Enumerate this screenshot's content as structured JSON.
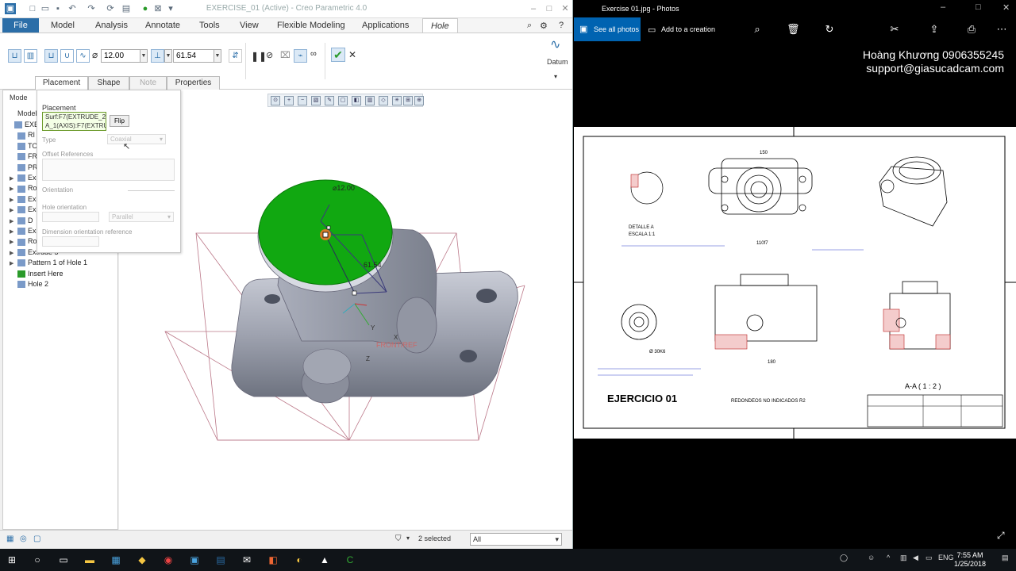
{
  "creo": {
    "window_title": "EXERCISE_01 (Active) - Creo Parametric 4.0",
    "menu": [
      "File",
      "Model",
      "Analysis",
      "Annotate",
      "Tools",
      "View",
      "Flexible Modeling",
      "Applications",
      "Hole"
    ],
    "ribbon": {
      "diameter_value": "12.00",
      "depth_value": "61.54",
      "datum_label": "Datum"
    },
    "dashboard_tabs": [
      "Placement",
      "Shape",
      "Note",
      "Properties"
    ],
    "placement_panel": {
      "heading": "Placement",
      "refs": [
        "Surf:F7(EXTRUDE_2)",
        "A_1(AXIS):F7(EXTRUD"
      ],
      "flip_label": "Flip",
      "type_label": "Type",
      "type_value": "Coaxial",
      "offset_label": "Offset References",
      "orientation_label": "Orientation",
      "hole_orientation_label": "Hole orientation",
      "hole_orientation_value": "Parallel",
      "dim_orientation_label": "Dimension orientation reference"
    },
    "model_tree": {
      "header_tab": "Mode",
      "header": "Model",
      "items": [
        {
          "label": "EXER",
          "indent": 0
        },
        {
          "label": "RI",
          "indent": 1
        },
        {
          "label": "TO",
          "indent": 1
        },
        {
          "label": "FR",
          "indent": 1
        },
        {
          "label": "PR",
          "indent": 1
        },
        {
          "label": "Ex",
          "indent": 1
        },
        {
          "label": "Ro",
          "indent": 1
        },
        {
          "label": "Ex",
          "indent": 1
        },
        {
          "label": "Ex",
          "indent": 1
        },
        {
          "label": "D",
          "indent": 1
        },
        {
          "label": "Ex",
          "indent": 1
        },
        {
          "label": "Ro",
          "indent": 1
        },
        {
          "label": "Extrude 5",
          "indent": 1
        },
        {
          "label": "Pattern 1 of Hole 1",
          "indent": 1
        },
        {
          "label": "Insert Here",
          "indent": 1
        },
        {
          "label": "Hole 2",
          "indent": 1
        }
      ]
    },
    "viewport": {
      "dim_diameter": "⌀12.00",
      "dim_depth": "61.54",
      "ref_label": "FRONT/REF"
    },
    "status": {
      "selected": "2 selected",
      "filter": "All"
    }
  },
  "photos": {
    "window_title": "Exercise 01.jpg - Photos",
    "see_all": "See all photos",
    "add_creation": "Add to a creation",
    "credit_line1": "Hoàng Khương 0906355245",
    "credit_line2": "support@giasucadcam.com",
    "drawing": {
      "title": "EJERCICIO 01",
      "subtitle": "REDONDEOS NO INDICADOS R2",
      "section_label": "A-A ( 1 : 2 )",
      "detail_label": "DETALLE A",
      "detail_scale": "ESCALA 1:1"
    }
  },
  "taskbar": {
    "time": "7:55 AM",
    "date": "1/25/2018",
    "lang": "ENG"
  }
}
